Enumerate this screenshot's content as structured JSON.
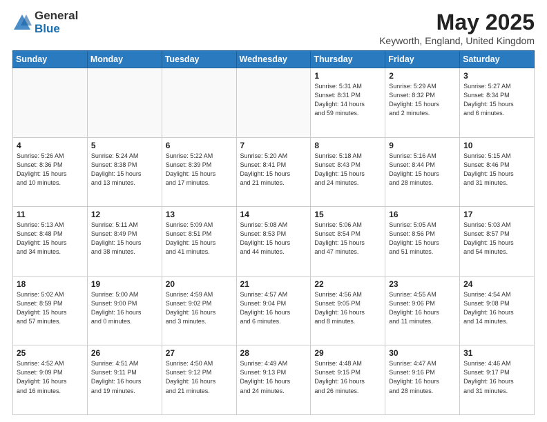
{
  "header": {
    "logo_general": "General",
    "logo_blue": "Blue",
    "title": "May 2025",
    "location": "Keyworth, England, United Kingdom"
  },
  "days_of_week": [
    "Sunday",
    "Monday",
    "Tuesday",
    "Wednesday",
    "Thursday",
    "Friday",
    "Saturday"
  ],
  "weeks": [
    [
      {
        "day": "",
        "info": ""
      },
      {
        "day": "",
        "info": ""
      },
      {
        "day": "",
        "info": ""
      },
      {
        "day": "",
        "info": ""
      },
      {
        "day": "1",
        "info": "Sunrise: 5:31 AM\nSunset: 8:31 PM\nDaylight: 14 hours\nand 59 minutes."
      },
      {
        "day": "2",
        "info": "Sunrise: 5:29 AM\nSunset: 8:32 PM\nDaylight: 15 hours\nand 2 minutes."
      },
      {
        "day": "3",
        "info": "Sunrise: 5:27 AM\nSunset: 8:34 PM\nDaylight: 15 hours\nand 6 minutes."
      }
    ],
    [
      {
        "day": "4",
        "info": "Sunrise: 5:26 AM\nSunset: 8:36 PM\nDaylight: 15 hours\nand 10 minutes."
      },
      {
        "day": "5",
        "info": "Sunrise: 5:24 AM\nSunset: 8:38 PM\nDaylight: 15 hours\nand 13 minutes."
      },
      {
        "day": "6",
        "info": "Sunrise: 5:22 AM\nSunset: 8:39 PM\nDaylight: 15 hours\nand 17 minutes."
      },
      {
        "day": "7",
        "info": "Sunrise: 5:20 AM\nSunset: 8:41 PM\nDaylight: 15 hours\nand 21 minutes."
      },
      {
        "day": "8",
        "info": "Sunrise: 5:18 AM\nSunset: 8:43 PM\nDaylight: 15 hours\nand 24 minutes."
      },
      {
        "day": "9",
        "info": "Sunrise: 5:16 AM\nSunset: 8:44 PM\nDaylight: 15 hours\nand 28 minutes."
      },
      {
        "day": "10",
        "info": "Sunrise: 5:15 AM\nSunset: 8:46 PM\nDaylight: 15 hours\nand 31 minutes."
      }
    ],
    [
      {
        "day": "11",
        "info": "Sunrise: 5:13 AM\nSunset: 8:48 PM\nDaylight: 15 hours\nand 34 minutes."
      },
      {
        "day": "12",
        "info": "Sunrise: 5:11 AM\nSunset: 8:49 PM\nDaylight: 15 hours\nand 38 minutes."
      },
      {
        "day": "13",
        "info": "Sunrise: 5:09 AM\nSunset: 8:51 PM\nDaylight: 15 hours\nand 41 minutes."
      },
      {
        "day": "14",
        "info": "Sunrise: 5:08 AM\nSunset: 8:53 PM\nDaylight: 15 hours\nand 44 minutes."
      },
      {
        "day": "15",
        "info": "Sunrise: 5:06 AM\nSunset: 8:54 PM\nDaylight: 15 hours\nand 47 minutes."
      },
      {
        "day": "16",
        "info": "Sunrise: 5:05 AM\nSunset: 8:56 PM\nDaylight: 15 hours\nand 51 minutes."
      },
      {
        "day": "17",
        "info": "Sunrise: 5:03 AM\nSunset: 8:57 PM\nDaylight: 15 hours\nand 54 minutes."
      }
    ],
    [
      {
        "day": "18",
        "info": "Sunrise: 5:02 AM\nSunset: 8:59 PM\nDaylight: 15 hours\nand 57 minutes."
      },
      {
        "day": "19",
        "info": "Sunrise: 5:00 AM\nSunset: 9:00 PM\nDaylight: 16 hours\nand 0 minutes."
      },
      {
        "day": "20",
        "info": "Sunrise: 4:59 AM\nSunset: 9:02 PM\nDaylight: 16 hours\nand 3 minutes."
      },
      {
        "day": "21",
        "info": "Sunrise: 4:57 AM\nSunset: 9:04 PM\nDaylight: 16 hours\nand 6 minutes."
      },
      {
        "day": "22",
        "info": "Sunrise: 4:56 AM\nSunset: 9:05 PM\nDaylight: 16 hours\nand 8 minutes."
      },
      {
        "day": "23",
        "info": "Sunrise: 4:55 AM\nSunset: 9:06 PM\nDaylight: 16 hours\nand 11 minutes."
      },
      {
        "day": "24",
        "info": "Sunrise: 4:54 AM\nSunset: 9:08 PM\nDaylight: 16 hours\nand 14 minutes."
      }
    ],
    [
      {
        "day": "25",
        "info": "Sunrise: 4:52 AM\nSunset: 9:09 PM\nDaylight: 16 hours\nand 16 minutes."
      },
      {
        "day": "26",
        "info": "Sunrise: 4:51 AM\nSunset: 9:11 PM\nDaylight: 16 hours\nand 19 minutes."
      },
      {
        "day": "27",
        "info": "Sunrise: 4:50 AM\nSunset: 9:12 PM\nDaylight: 16 hours\nand 21 minutes."
      },
      {
        "day": "28",
        "info": "Sunrise: 4:49 AM\nSunset: 9:13 PM\nDaylight: 16 hours\nand 24 minutes."
      },
      {
        "day": "29",
        "info": "Sunrise: 4:48 AM\nSunset: 9:15 PM\nDaylight: 16 hours\nand 26 minutes."
      },
      {
        "day": "30",
        "info": "Sunrise: 4:47 AM\nSunset: 9:16 PM\nDaylight: 16 hours\nand 28 minutes."
      },
      {
        "day": "31",
        "info": "Sunrise: 4:46 AM\nSunset: 9:17 PM\nDaylight: 16 hours\nand 31 minutes."
      }
    ]
  ]
}
